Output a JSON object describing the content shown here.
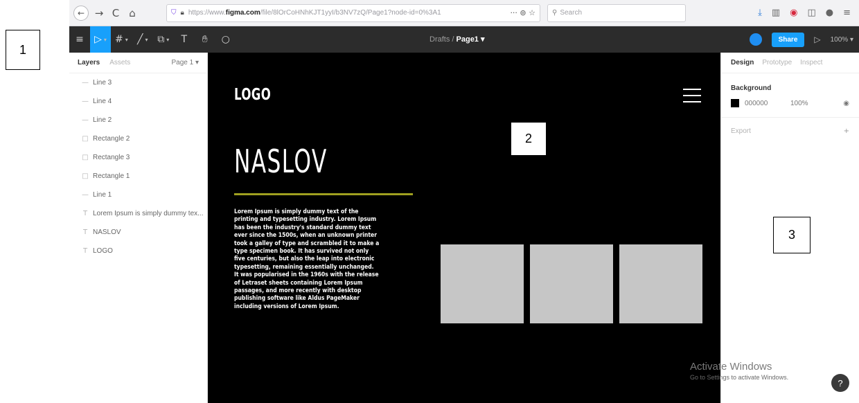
{
  "browser": {
    "back_icon": "←",
    "forward_icon": "→",
    "reload_icon": "C",
    "home_icon": "⌂",
    "url_prefix": "https://www.",
    "url_domain": "figma.com",
    "url_rest": "/file/8lOrCoHNhKJT1yyI/b3NV7zQ/Page1?node-id=0%3A1",
    "page_actions": "··· ⊚ ☆",
    "search_placeholder": "Search"
  },
  "figma": {
    "title_drafts": "Drafts",
    "title_separator": " / ",
    "title_page": "Page1 ▾",
    "share_label": "Share",
    "zoom_label": "100% ▾"
  },
  "layers_panel": {
    "tab_layers": "Layers",
    "tab_assets": "Assets",
    "page_selector": "Page 1 ▾",
    "items": [
      {
        "icon": "—",
        "label": "Line 3"
      },
      {
        "icon": "—",
        "label": "Line 4"
      },
      {
        "icon": "—",
        "label": "Line 2"
      },
      {
        "icon": "□",
        "label": "Rectangle 2"
      },
      {
        "icon": "□",
        "label": "Rectangle 3"
      },
      {
        "icon": "□",
        "label": "Rectangle 1"
      },
      {
        "icon": "—",
        "label": "Line 1"
      },
      {
        "icon": "T",
        "label": "Lorem Ipsum is simply dummy tex..."
      },
      {
        "icon": "T",
        "label": "NASLOV"
      },
      {
        "icon": "T",
        "label": "LOGO"
      }
    ]
  },
  "canvas": {
    "logo": "LOGO",
    "heading": "NASLOV",
    "accent_color": "#9fa020",
    "body": "Lorem Ipsum is simply dummy text of the printing and typesetting industry. Lorem Ipsum has been the industry's standard dummy text ever since the 1500s, when an unknown printer took a galley of type and scrambled it to make a type specimen book. It has survived not only five centuries, but also the leap into electronic typesetting, remaining essentially unchanged. It was popularised in the 1960s with the release of Letraset sheets containing Lorem Ipsum passages, and more recently with desktop publishing software like Aldus PageMaker including versions of Lorem Ipsum."
  },
  "design_panel": {
    "tab_design": "Design",
    "tab_prototype": "Prototype",
    "tab_inspect": "Inspect",
    "background_title": "Background",
    "background_hex": "000000",
    "background_opacity": "100%",
    "background_color": "#000000",
    "export_label": "Export",
    "export_add": "+"
  },
  "callouts": {
    "one": "1",
    "two": "2",
    "three": "3"
  },
  "watermark": {
    "line1": "Activate Windows",
    "line2": "Go to Settings to activate Windows."
  },
  "help": "?"
}
